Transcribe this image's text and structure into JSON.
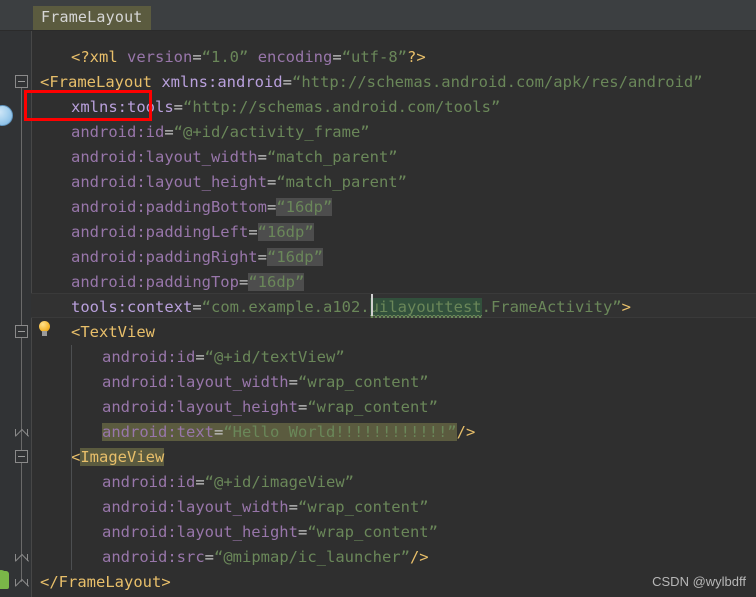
{
  "window": {
    "background_color": "#2f2f2f",
    "gutter_color": "#313335"
  },
  "breadcrumb": {
    "label": "FrameLayout",
    "highlight_color": "#5b5b3f"
  },
  "icons": {
    "layout_preview": "layout-preview-icon",
    "android_robot": "android-robot-icon",
    "intention_bulb": "lightbulb-icon"
  },
  "annotation": {
    "color": "#ff0000",
    "target": "FrameLayout"
  },
  "editor": {
    "language": "xml",
    "caret_line_index": 8,
    "colors": {
      "tag": "#e8bf6a",
      "attribute": "#9876aa",
      "value": "#6a8759",
      "text": "#a9b7c6",
      "search_highlight": "#5b5b3f",
      "occurrence_highlight": "#4d4d4d",
      "identifier_highlight": "#32503c"
    },
    "lines": [
      {
        "n": 1,
        "indent": 1,
        "tokens": [
          {
            "t": "<?xml ",
            "c": "proc"
          },
          {
            "t": "version",
            "c": "attr"
          },
          {
            "t": "=",
            "c": "eq"
          },
          {
            "t": "“1.0”",
            "c": "val"
          },
          {
            "t": " ",
            "c": "plain"
          },
          {
            "t": "encoding",
            "c": "attr"
          },
          {
            "t": "=",
            "c": "eq"
          },
          {
            "t": "“utf-8”",
            "c": "val"
          },
          {
            "t": "?>",
            "c": "proc"
          }
        ]
      },
      {
        "n": 2,
        "indent": 0,
        "tokens": [
          {
            "t": "<FrameLayout",
            "c": "tag"
          },
          {
            "t": " ",
            "c": "plain"
          },
          {
            "t": "xmlns:android",
            "c": "ns"
          },
          {
            "t": "=",
            "c": "eq"
          },
          {
            "t": "“http://schemas.android.com/apk/res/android”",
            "c": "val"
          }
        ]
      },
      {
        "n": 3,
        "indent": 1,
        "tokens": [
          {
            "t": "xmlns:tools",
            "c": "ns"
          },
          {
            "t": "=",
            "c": "eq"
          },
          {
            "t": "“http://schemas.android.com/tools”",
            "c": "val"
          }
        ]
      },
      {
        "n": 4,
        "indent": 1,
        "tokens": [
          {
            "t": "android:id",
            "c": "attr"
          },
          {
            "t": "=",
            "c": "eq"
          },
          {
            "t": "“@+id/activity_frame”",
            "c": "val"
          }
        ]
      },
      {
        "n": 5,
        "indent": 1,
        "tokens": [
          {
            "t": "android:layout_width",
            "c": "attr"
          },
          {
            "t": "=",
            "c": "eq"
          },
          {
            "t": "“match_parent”",
            "c": "val"
          }
        ]
      },
      {
        "n": 6,
        "indent": 1,
        "tokens": [
          {
            "t": "android:layout_height",
            "c": "attr"
          },
          {
            "t": "=",
            "c": "eq"
          },
          {
            "t": "“match_parent”",
            "c": "val"
          }
        ]
      },
      {
        "n": 7,
        "indent": 1,
        "tokens": [
          {
            "t": "android:paddingBottom",
            "c": "attr"
          },
          {
            "t": "=",
            "c": "eq"
          },
          {
            "t": "“16dp”",
            "c": "val",
            "hl": "soft"
          }
        ]
      },
      {
        "n": 8,
        "indent": 1,
        "tokens": [
          {
            "t": "android:paddingLeft",
            "c": "attr"
          },
          {
            "t": "=",
            "c": "eq"
          },
          {
            "t": "“16dp”",
            "c": "val",
            "hl": "soft"
          }
        ]
      },
      {
        "n": 9,
        "indent": 1,
        "tokens": [
          {
            "t": "android:paddingRight",
            "c": "attr"
          },
          {
            "t": "=",
            "c": "eq"
          },
          {
            "t": "“16dp”",
            "c": "val",
            "hl": "soft"
          }
        ]
      },
      {
        "n": 10,
        "indent": 1,
        "tokens": [
          {
            "t": "android:paddingTop",
            "c": "attr"
          },
          {
            "t": "=",
            "c": "eq"
          },
          {
            "t": "“16dp”",
            "c": "val",
            "hl": "soft"
          }
        ]
      },
      {
        "n": 11,
        "indent": 1,
        "caret": true,
        "tokens": [
          {
            "t": "tools:context",
            "c": "ns"
          },
          {
            "t": "=",
            "c": "eq"
          },
          {
            "t": "“com.example.a102.",
            "c": "val"
          },
          {
            "t": "uilayouttest",
            "c": "val",
            "hl": "green",
            "squiggle": true
          },
          {
            "t": ".FrameActivity”",
            "c": "val"
          },
          {
            "t": ">",
            "c": "tag"
          }
        ]
      },
      {
        "n": 12,
        "indent": 1,
        "tokens": [
          {
            "t": "<TextView",
            "c": "tag"
          }
        ]
      },
      {
        "n": 13,
        "indent": 2,
        "tokens": [
          {
            "t": "android:id",
            "c": "attr"
          },
          {
            "t": "=",
            "c": "eq"
          },
          {
            "t": "“@+id/textView”",
            "c": "val"
          }
        ]
      },
      {
        "n": 14,
        "indent": 2,
        "tokens": [
          {
            "t": "android:layout_width",
            "c": "attr"
          },
          {
            "t": "=",
            "c": "eq"
          },
          {
            "t": "“wrap_content”",
            "c": "val"
          }
        ]
      },
      {
        "n": 15,
        "indent": 2,
        "tokens": [
          {
            "t": "android:layout_height",
            "c": "attr"
          },
          {
            "t": "=",
            "c": "eq"
          },
          {
            "t": "“wrap_content”",
            "c": "val"
          }
        ]
      },
      {
        "n": 16,
        "indent": 2,
        "tokens": [
          {
            "t": "android:text",
            "c": "attr",
            "hl": "search"
          },
          {
            "t": "=",
            "c": "eq",
            "hl": "search"
          },
          {
            "t": "“Hello World!!!!!!!!!!!!”",
            "c": "val",
            "hl": "search"
          },
          {
            "t": "/>",
            "c": "tag"
          }
        ]
      },
      {
        "n": 17,
        "indent": 1,
        "tokens": [
          {
            "t": "<",
            "c": "tag"
          },
          {
            "t": "ImageView",
            "c": "tag",
            "hl": "search"
          }
        ]
      },
      {
        "n": 18,
        "indent": 2,
        "tokens": [
          {
            "t": "android:id",
            "c": "attr"
          },
          {
            "t": "=",
            "c": "eq"
          },
          {
            "t": "“@+id/imageView”",
            "c": "val"
          }
        ]
      },
      {
        "n": 19,
        "indent": 2,
        "tokens": [
          {
            "t": "android:layout_width",
            "c": "attr"
          },
          {
            "t": "=",
            "c": "eq"
          },
          {
            "t": "“wrap_content”",
            "c": "val"
          }
        ]
      },
      {
        "n": 20,
        "indent": 2,
        "tokens": [
          {
            "t": "android:layout_height",
            "c": "attr"
          },
          {
            "t": "=",
            "c": "eq"
          },
          {
            "t": "“wrap_content”",
            "c": "val"
          }
        ]
      },
      {
        "n": 21,
        "indent": 2,
        "tokens": [
          {
            "t": "android:src",
            "c": "attr"
          },
          {
            "t": "=",
            "c": "eq"
          },
          {
            "t": "“@mipmap/ic_launcher”",
            "c": "val"
          },
          {
            "t": "/>",
            "c": "tag"
          }
        ]
      },
      {
        "n": 22,
        "indent": 0,
        "tokens": [
          {
            "t": "</FrameLayout>",
            "c": "tag"
          }
        ]
      }
    ]
  },
  "watermark": {
    "text": "CSDN @wylbdff"
  }
}
